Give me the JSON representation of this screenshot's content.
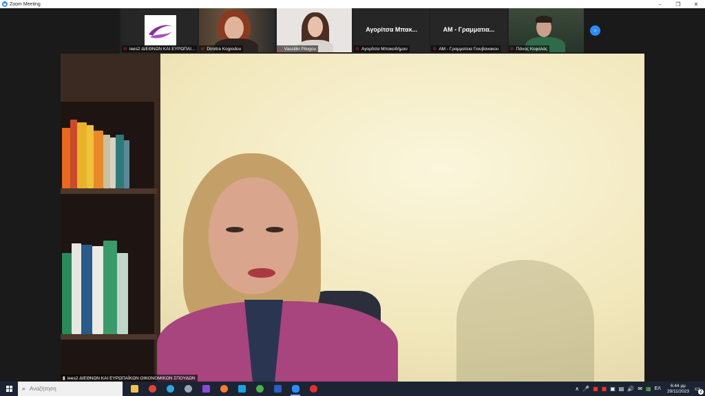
{
  "window": {
    "title": "Zoom Meeting",
    "minimize": "–",
    "maximize": "❐",
    "close": "✕"
  },
  "gallery": {
    "tiles": [
      {
        "name": "iees2 ΔΙΕΘΝΩΝ ΚΑΙ ΕΥΡΩΠΑΪ...",
        "type": "logo"
      },
      {
        "name": "Dimitra Kogiodou",
        "type": "video"
      },
      {
        "name": "Vassiliki Pilogou",
        "type": "video"
      },
      {
        "name": "Αγορίτσα Μπακοδήμου",
        "display": "Αγορίτσα Μπακ...",
        "type": "name"
      },
      {
        "name": "AM - Γραμματεια Γιουβανακου",
        "display": "AM - Γραμματια...",
        "type": "name"
      },
      {
        "name": "Πάνος Κεφαλάς",
        "type": "video"
      }
    ],
    "next_icon": "›"
  },
  "speaker": {
    "name": "iees2 ΔΙΕΘΝΩΝ ΚΑΙ ΕΥΡΩΠΑΪΚΩΝ ΟΙΚΟΝΟΜΙΚΩΝ ΣΠΟΥΔΩΝ",
    "signal_icon": "▮"
  },
  "taskbar": {
    "search_placeholder": "Αναζήτηση",
    "search_icon": "⌕",
    "apps": [
      {
        "name": "file-explorer",
        "color": "#f2c14e"
      },
      {
        "name": "chrome",
        "color": "#e94235"
      },
      {
        "name": "edge",
        "color": "#2fa7e0"
      },
      {
        "name": "photos",
        "color": "#9aa6b8"
      },
      {
        "name": "app-purple",
        "color": "#8a4bd6"
      },
      {
        "name": "firefox",
        "color": "#ff7b2e"
      },
      {
        "name": "skype",
        "color": "#1da1e2"
      },
      {
        "name": "chrome-2",
        "color": "#4caf50"
      },
      {
        "name": "word",
        "color": "#2b5fbd"
      },
      {
        "name": "zoom",
        "color": "#2d8cff"
      },
      {
        "name": "recorder",
        "color": "#d33"
      }
    ],
    "tray": {
      "up_arrow": "∧",
      "mic": "🎤",
      "icons": [
        "■",
        "■",
        "▣",
        "▤",
        "🔊",
        "✉",
        "▦"
      ],
      "language": "ΕΛ",
      "time": "6:44 μμ",
      "date": "29/11/2023",
      "notifications": "2",
      "notif_icon": "▭"
    }
  }
}
